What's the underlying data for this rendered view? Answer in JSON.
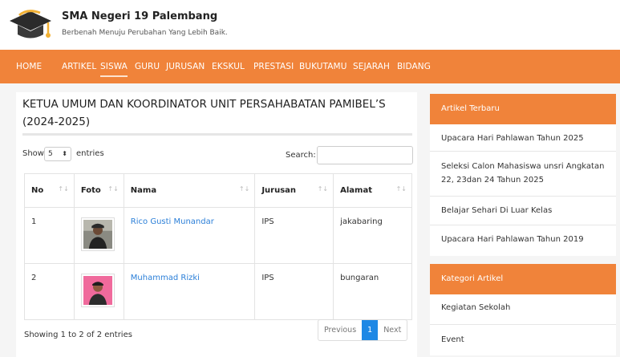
{
  "header": {
    "title": "SMA Negeri 19 Palembang",
    "tagline": "Berbenah Menuju Perubahan Yang Lebih Baik."
  },
  "nav": {
    "items": [
      "HOME",
      "ARTIKEL",
      "SISWA",
      "GURU",
      "JURUSAN",
      "EKSKUL",
      "PRESTASI",
      "BUKUTAMU",
      "SEJARAH",
      "BIDANG"
    ],
    "active": "SISWA"
  },
  "main": {
    "title": "KETUA UMUM DAN KOORDINATOR UNIT PERSAHABATAN PAMIBEL’S (2024-2025)",
    "show_label": "Show",
    "entries_value": "5",
    "entries_label": "entries",
    "search_label": "Search:",
    "search_value": "",
    "table": {
      "headers": [
        "No",
        "Foto",
        "Nama",
        "Jurusan",
        "Alamat"
      ],
      "rows": [
        {
          "no": "1",
          "nama": "Rico Gusti Munandar",
          "jurusan": "IPS",
          "alamat": "jakabaring"
        },
        {
          "no": "2",
          "nama": "Muhammad Rizki",
          "jurusan": "IPS",
          "alamat": "bungaran"
        }
      ]
    },
    "info": "Showing 1 to 2 of 2 entries",
    "pager": {
      "previous": "Previous",
      "current": "1",
      "next": "Next"
    }
  },
  "sidebar": {
    "articles_title": "Artikel Terbaru",
    "articles": [
      "Upacara Hari Pahlawan Tahun 2025",
      "Seleksi Calon Mahasiswa unsri Angkatan 22, 23dan 24 Tahun 2025",
      "Belajar Sehari Di Luar Kelas",
      "Upacara Hari Pahlawan Tahun 2019"
    ],
    "categories_title": "Kategori Artikel",
    "categories": [
      "Kegiatan Sekolah",
      "Event"
    ]
  },
  "colors": {
    "accent": "#f0833a",
    "link": "#2b7fd8",
    "pager_active": "#1e88e5"
  },
  "icons": {
    "logo": "graduation-cap-icon",
    "sort": "sort-icon",
    "select": "select-arrow-icon"
  }
}
